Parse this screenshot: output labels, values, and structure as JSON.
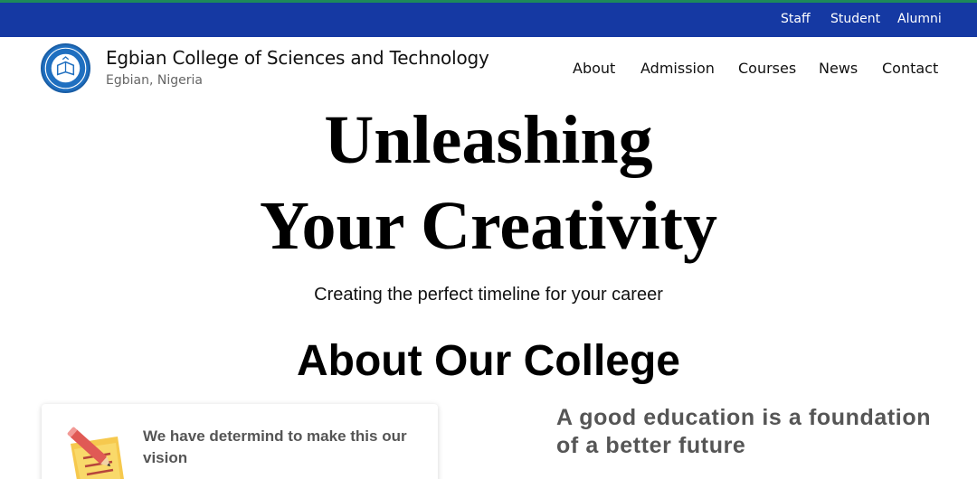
{
  "topbar": {
    "links": [
      "Staff",
      "Student",
      "Alumni"
    ],
    "color": "#1539a3"
  },
  "brand": {
    "title": "Egbian College of Sciences and Technology",
    "subtitle": "Egbian, Nigeria",
    "logo_icon": "college-crest-icon"
  },
  "nav": {
    "items": [
      "About",
      "Admission",
      "Courses",
      "News",
      "Contact"
    ]
  },
  "hero": {
    "title_line1": "Unleashing",
    "title_line2": "Your Creativity",
    "subtitle": "Creating the perfect timeline for your career"
  },
  "about": {
    "title": "About Our College",
    "card": {
      "icon": "notepad-pencil-icon",
      "text": "We have determind to make this our vision"
    },
    "tagline": "A good education is a foundation of a better future"
  }
}
